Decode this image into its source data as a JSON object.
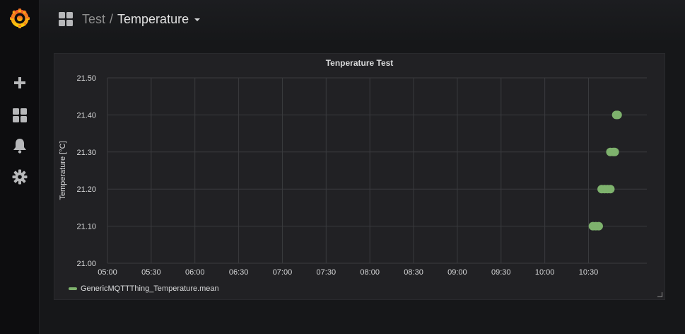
{
  "sidebar": {
    "items": [
      {
        "name": "grafana-logo",
        "icon": "grafana-logo-icon"
      },
      {
        "name": "create",
        "icon": "plus-icon"
      },
      {
        "name": "dashboards",
        "icon": "grid-icon"
      },
      {
        "name": "alerting",
        "icon": "bell-icon"
      },
      {
        "name": "configuration",
        "icon": "gear-icon"
      }
    ]
  },
  "header": {
    "icon": "dashboard-grid-icon",
    "folder": "Test",
    "separator": "/",
    "dashboard": "Temperature"
  },
  "colors": {
    "series": "#7eb26d",
    "grid": "#3a3b3e",
    "text": "#d8d9da",
    "panel_bg": "#212124"
  },
  "panel": {
    "title": "Tenperature Test"
  },
  "chart_data": {
    "type": "scatter",
    "title": "Tenperature Test",
    "xlabel": "",
    "ylabel": "Temperature [°C]",
    "ylim": [
      21.0,
      21.5
    ],
    "xlim": [
      "05:00",
      "11:10"
    ],
    "yticks": [
      "21.00",
      "21.10",
      "21.20",
      "21.30",
      "21.40",
      "21.50"
    ],
    "xticks": [
      "05:00",
      "05:30",
      "06:00",
      "06:30",
      "07:00",
      "07:30",
      "08:00",
      "08:30",
      "09:00",
      "09:30",
      "10:00",
      "10:30"
    ],
    "grid": true,
    "legend_position": "bottom-left",
    "series": [
      {
        "name": "GenericMQTTThing_Temperature.mean",
        "color": "#7eb26d",
        "points": [
          {
            "x": "10:33",
            "y": 21.1
          },
          {
            "x": "10:35",
            "y": 21.1
          },
          {
            "x": "10:37",
            "y": 21.1
          },
          {
            "x": "10:39",
            "y": 21.2
          },
          {
            "x": "10:41",
            "y": 21.2
          },
          {
            "x": "10:43",
            "y": 21.2
          },
          {
            "x": "10:45",
            "y": 21.2
          },
          {
            "x": "10:45",
            "y": 21.3
          },
          {
            "x": "10:47",
            "y": 21.3
          },
          {
            "x": "10:48",
            "y": 21.3
          },
          {
            "x": "10:49",
            "y": 21.4
          },
          {
            "x": "10:50",
            "y": 21.4
          }
        ]
      }
    ]
  }
}
